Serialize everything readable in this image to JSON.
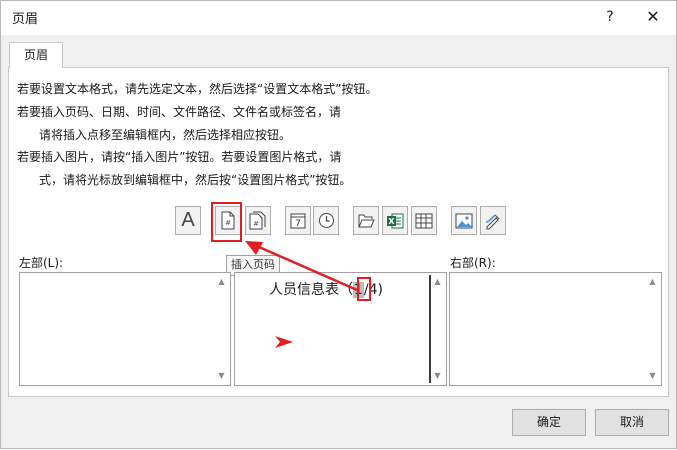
{
  "window": {
    "title": "页眉",
    "help_label": "?",
    "close_label": "✕"
  },
  "tab": {
    "label": "页眉"
  },
  "instructions": [
    "若要设置文本格式，请先选定文本，然后选择“设置文本格式”按钮。",
    "若要插入页码、日期、时间、文件路径、文件名或标签名，请",
    "请将插入点移至编辑框内，然后选择相应按钮。",
    "若要插入图片，请按“插入图片”按钮。若要设置图片格式，请",
    "式，请将光标放到编辑框中，然后按“设置图片格式”按钮。"
  ],
  "toolbar": {
    "format_text_label": "A",
    "date_glyph": "7",
    "icons": [
      "format-text-icon",
      "insert-page-number-icon",
      "insert-page-count-icon",
      "insert-date-icon",
      "insert-time-icon",
      "insert-file-path-icon",
      "insert-file-name-icon",
      "insert-sheet-name-icon",
      "insert-picture-icon",
      "format-picture-icon"
    ]
  },
  "tooltip": {
    "text": "插入页码"
  },
  "sections": {
    "left_label": "左部(L):",
    "right_label": "右部(R):",
    "center_value_before": "人员信息表（",
    "center_value_cursor": "1",
    "center_value_after": "/4)"
  },
  "buttons": {
    "ok_label": "确定",
    "cancel_label": "取消"
  },
  "colors": {
    "highlight_red": "#e02020",
    "excel_green": "#1e7145"
  }
}
